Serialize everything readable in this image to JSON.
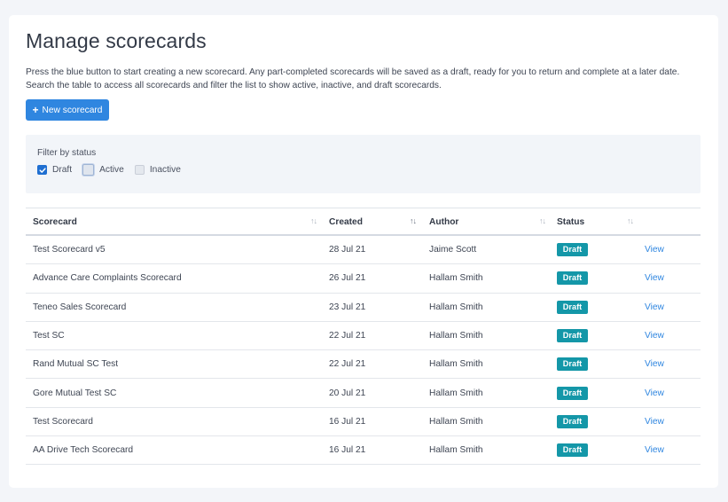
{
  "page": {
    "title": "Manage scorecards",
    "intro": "Press the blue button to start creating a new scorecard. Any part-completed scorecards will be saved as a draft, ready for you to return and complete at a later date. Search the table to access all scorecards and filter the list to show active, inactive, and draft scorecards."
  },
  "actions": {
    "new_scorecard_label": "New scorecard",
    "new_icon": "plus-icon"
  },
  "filter": {
    "title": "Filter by status",
    "options": [
      {
        "label": "Draft",
        "checked": true
      },
      {
        "label": "Active",
        "checked": false
      },
      {
        "label": "Inactive",
        "checked": false
      }
    ]
  },
  "table": {
    "headers": [
      "Scorecard",
      "Created",
      "Author",
      "Status"
    ],
    "sort_icon": "↑↓",
    "sort_icon_names": [
      "sort-arrows-icon"
    ],
    "rows": [
      {
        "name": "Test Scorecard v5",
        "created": "28 Jul 21",
        "author": "Jaime Scott",
        "status": "Draft",
        "action": "View"
      },
      {
        "name": "Advance Care Complaints Scorecard",
        "created": "26 Jul 21",
        "author": "Hallam Smith",
        "status": "Draft",
        "action": "View"
      },
      {
        "name": "Teneo Sales Scorecard",
        "created": "23 Jul 21",
        "author": "Hallam Smith",
        "status": "Draft",
        "action": "View"
      },
      {
        "name": "Test SC",
        "created": "22 Jul 21",
        "author": "Hallam Smith",
        "status": "Draft",
        "action": "View"
      },
      {
        "name": "Rand Mutual SC Test",
        "created": "22 Jul 21",
        "author": "Hallam Smith",
        "status": "Draft",
        "action": "View"
      },
      {
        "name": "Gore Mutual Test SC",
        "created": "20 Jul 21",
        "author": "Hallam Smith",
        "status": "Draft",
        "action": "View"
      },
      {
        "name": "Test Scorecard",
        "created": "16 Jul 21",
        "author": "Hallam Smith",
        "status": "Draft",
        "action": "View"
      },
      {
        "name": "AA Drive Tech Scorecard",
        "created": "16 Jul 21",
        "author": "Hallam Smith",
        "status": "Draft",
        "action": "View"
      }
    ]
  },
  "colors": {
    "primary": "#2f86e0",
    "badge": "#1497a8",
    "checkbox": "#1f6fd1",
    "background": "#f3f5f9"
  }
}
